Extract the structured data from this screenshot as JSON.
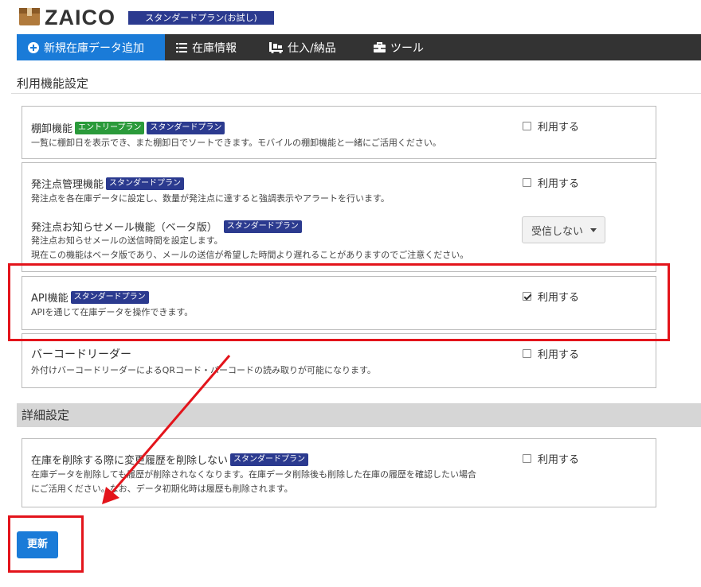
{
  "header": {
    "logo": "ZAICO",
    "plan_badge": "スタンダードプラン(お試し)"
  },
  "nav": {
    "items": [
      {
        "label": "新規在庫データ追加",
        "icon": "plus-circle-icon",
        "active": true
      },
      {
        "label": "在庫情報",
        "icon": "list-icon"
      },
      {
        "label": "仕入/納品",
        "icon": "cart-icon"
      },
      {
        "label": "ツール",
        "icon": "toolbox-icon"
      }
    ]
  },
  "sections": {
    "feature_settings": "利用機能設定",
    "detail_settings": "詳細設定"
  },
  "features": {
    "stocktake": {
      "title": "棚卸機能",
      "tags": [
        "エントリープラン",
        "スタンダードプラン"
      ],
      "desc": "一覧に棚卸日を表示でき、また棚卸日でソートできます。モバイルの棚卸機能と一緒にご活用ください。",
      "check_label": "利用する",
      "checked": false
    },
    "reorder": {
      "title": "発注点管理機能",
      "tag": "スタンダードプラン",
      "desc": "発注点を各在庫データに設定し、数量が発注点に達すると強調表示やアラートを行います。",
      "check_label": "利用する",
      "checked": false
    },
    "reorder_mail": {
      "title": "発注点お知らせメール機能（ベータ版）",
      "tag": "スタンダードプラン",
      "desc1": "発注点お知らせメールの送信時間を設定します。",
      "desc2": "現在この機能はベータ版であり、メールの送信が希望した時間より遅れることがありますのでご注意ください。",
      "select_value": "受信しない"
    },
    "api": {
      "title": "API機能",
      "tag": "スタンダードプラン",
      "desc": "APIを通じて在庫データを操作できます。",
      "check_label": "利用する",
      "checked": true
    },
    "barcode": {
      "title": "バーコードリーダー",
      "desc": "外付けバーコードリーダーによるQRコード・バーコードの読み取りが可能になります。",
      "check_label": "利用する",
      "checked": false
    },
    "history": {
      "title": "在庫を削除する際に変更履歴を削除しない",
      "tag": "スタンダードプラン",
      "desc1": "在庫データを削除しても履歴が削除されなくなります。在庫データ削除後も削除した在庫の履歴を確認したい場合",
      "desc2": "にご活用ください。なお、データ初期化時は履歴も削除されます。",
      "check_label": "利用する",
      "checked": false
    }
  },
  "update_button": "更新",
  "colors": {
    "nav_bg": "#333333",
    "accent": "#1a7bd8",
    "plan_tag": "#2b3a8f",
    "entry_tag": "#2a9a3a",
    "annotation": "#e3141b"
  }
}
